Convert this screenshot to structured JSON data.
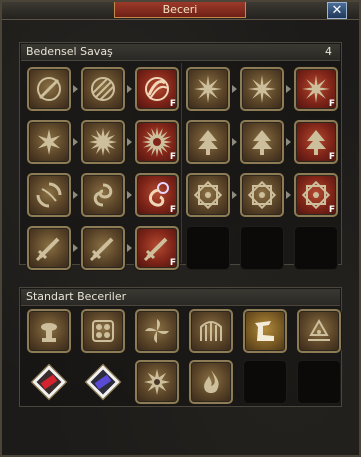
{
  "window": {
    "title": "Beceri",
    "close_symbol": "✕"
  },
  "combat": {
    "header_label": "Bedensel Savaş",
    "points": "4",
    "left_rows": [
      [
        {
          "icon": "slash-icon",
          "tone": "brown"
        },
        {
          "icon": "triple-slash-icon",
          "tone": "brown"
        },
        {
          "icon": "swirl-slash-icon",
          "tone": "red",
          "badge": "F"
        }
      ],
      [
        {
          "icon": "leaf-burst-icon",
          "tone": "brown"
        },
        {
          "icon": "radiant-burst-icon",
          "tone": "brown"
        },
        {
          "icon": "sunburst-icon",
          "tone": "red",
          "badge": "F"
        }
      ],
      [
        {
          "icon": "cyclone-icon",
          "tone": "brown"
        },
        {
          "icon": "vortex-icon",
          "tone": "brown"
        },
        {
          "icon": "orb-whirl-icon",
          "tone": "red",
          "badge": "F"
        }
      ],
      [
        {
          "icon": "sword-icon",
          "tone": "brown"
        },
        {
          "icon": "sword-icon",
          "tone": "brown"
        },
        {
          "icon": "sword-icon",
          "tone": "red",
          "badge": "F"
        }
      ]
    ],
    "right_rows": [
      [
        {
          "icon": "spinning-star-icon",
          "tone": "brown"
        },
        {
          "icon": "spinning-star-icon",
          "tone": "brown"
        },
        {
          "icon": "spinning-star-icon",
          "tone": "red",
          "badge": "F"
        }
      ],
      [
        {
          "icon": "pine-tree-icon",
          "tone": "brown"
        },
        {
          "icon": "pine-tree-icon",
          "tone": "brown"
        },
        {
          "icon": "pine-tree-icon",
          "tone": "red",
          "badge": "F"
        }
      ],
      [
        {
          "icon": "mandala-icon",
          "tone": "brown"
        },
        {
          "icon": "mandala-icon",
          "tone": "brown"
        },
        {
          "icon": "mandala-icon",
          "tone": "red",
          "badge": "F"
        }
      ]
    ]
  },
  "standard": {
    "header_label": "Standart Beceriler",
    "row1": [
      {
        "icon": "brazier-icon",
        "tone": "brown"
      },
      {
        "icon": "shell-pattern-icon",
        "tone": "brown"
      },
      {
        "icon": "pinwheel-icon",
        "tone": "brown"
      },
      {
        "icon": "gate-icon",
        "tone": "brown"
      },
      {
        "icon": "horse-boot-icon",
        "tone": "gold"
      },
      {
        "icon": "campfire-icon",
        "tone": "brown"
      }
    ],
    "row2": [
      {
        "icon": "red-gem-icon",
        "tone": "plain"
      },
      {
        "icon": "blue-gem-icon",
        "tone": "plain"
      },
      {
        "icon": "compass-star-icon",
        "tone": "brown"
      },
      {
        "icon": "flame-icon",
        "tone": "brown"
      }
    ]
  },
  "colors": {
    "accent_red": "#9b3a2a",
    "frame_gold": "#8c7b55",
    "close_blue": "#2f4f78"
  }
}
